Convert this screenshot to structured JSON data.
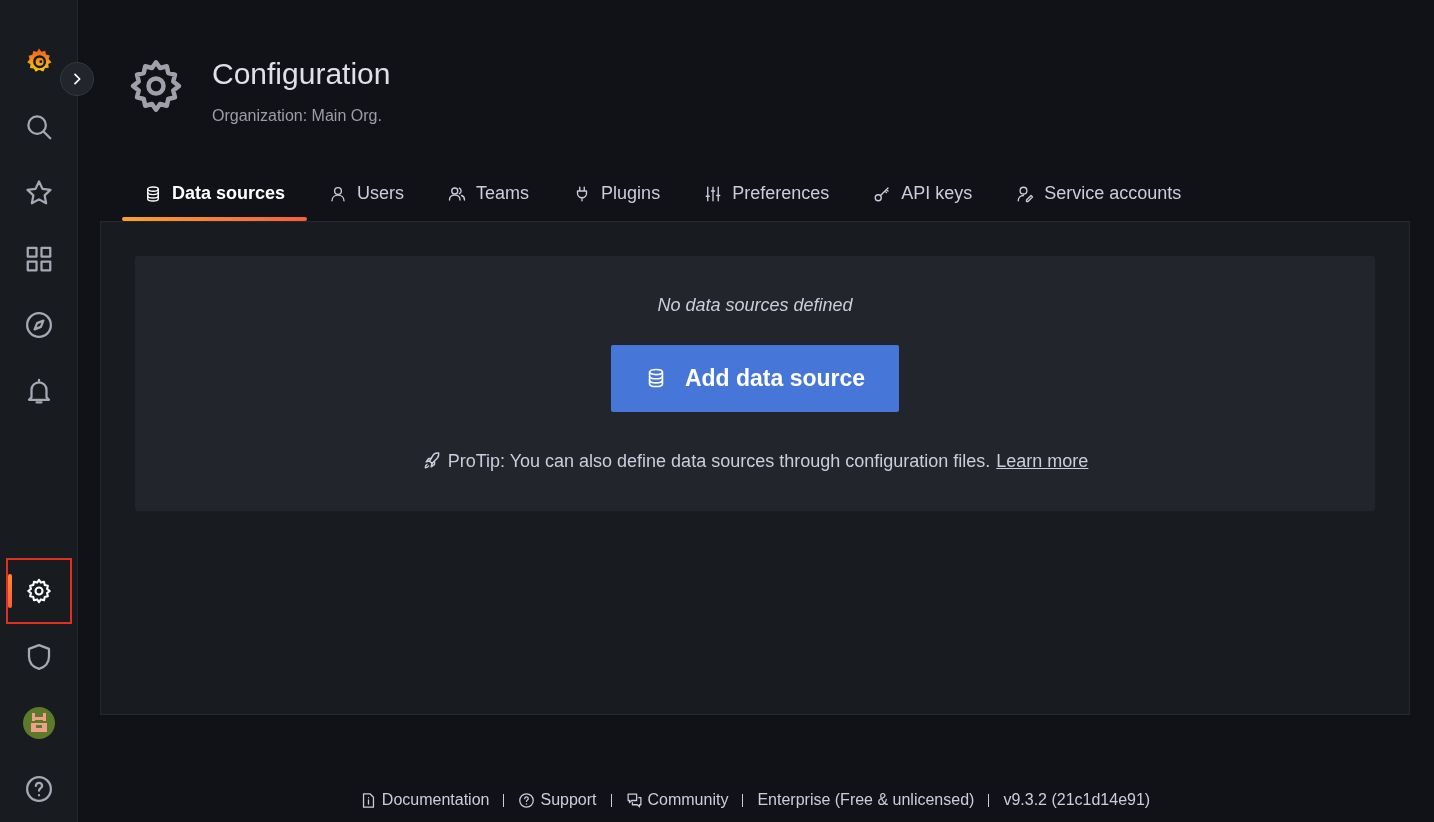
{
  "sidebar": {
    "items": [
      {
        "kind": "logo",
        "selected": false,
        "highlighted": false
      },
      {
        "kind": "search",
        "selected": false,
        "highlighted": false
      },
      {
        "kind": "star",
        "selected": false,
        "highlighted": false
      },
      {
        "kind": "dashboards",
        "selected": false,
        "highlighted": false
      },
      {
        "kind": "explore",
        "selected": false,
        "highlighted": false
      },
      {
        "kind": "alerting",
        "selected": false,
        "highlighted": false
      }
    ],
    "bottom_items": [
      {
        "kind": "settings",
        "selected": true,
        "highlighted": true
      },
      {
        "kind": "shield",
        "selected": false,
        "highlighted": false
      },
      {
        "kind": "avatar",
        "selected": false,
        "highlighted": false
      },
      {
        "kind": "help",
        "selected": false,
        "highlighted": false
      }
    ]
  },
  "header": {
    "title": "Configuration",
    "subtitle": "Organization: Main Org."
  },
  "tabs": [
    {
      "label": "Data sources",
      "selected": true
    },
    {
      "label": "Users",
      "selected": false
    },
    {
      "label": "Teams",
      "selected": false
    },
    {
      "label": "Plugins",
      "selected": false
    },
    {
      "label": "Preferences",
      "selected": false
    },
    {
      "label": "API keys",
      "selected": false
    },
    {
      "label": "Service accounts",
      "selected": false
    }
  ],
  "empty_state": {
    "message": "No data sources defined",
    "button": "Add data source",
    "protip": "ProTip: You can also define data sources through configuration files.",
    "link": "Learn more"
  },
  "footer": [
    {
      "label": "Documentation",
      "kind": "link"
    },
    {
      "label": "Support",
      "kind": "link"
    },
    {
      "label": "Community",
      "kind": "link"
    },
    {
      "label": "Enterprise (Free & unlicensed)",
      "kind": "text"
    },
    {
      "label": "v9.3.2 (21c1d14e91)",
      "kind": "text"
    }
  ]
}
